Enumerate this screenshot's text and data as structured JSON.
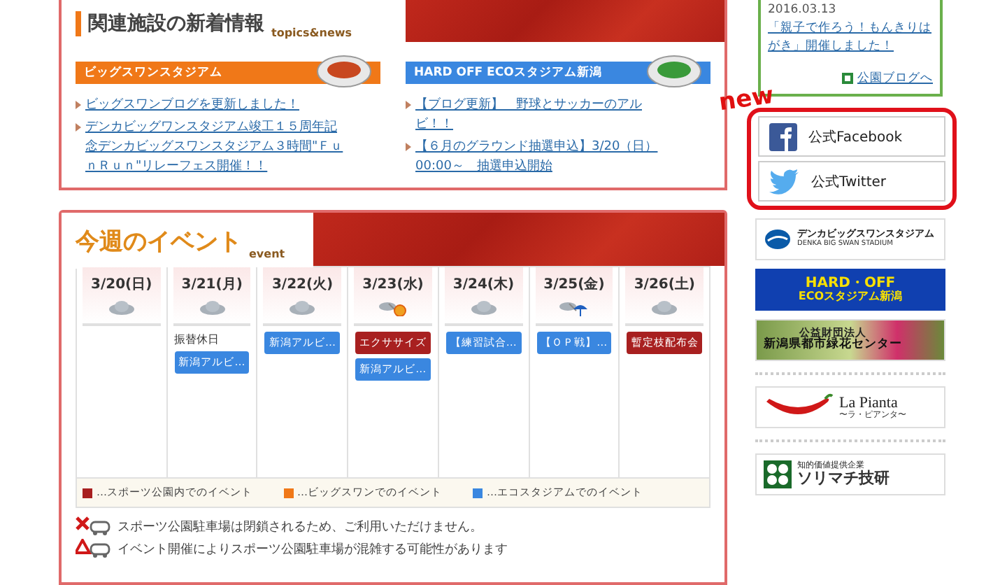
{
  "topics": {
    "title": "関連施設の新着情報",
    "subtitle": "topics&news",
    "venues": [
      {
        "name": "ビッグスワンスタジアム",
        "kind": "swan",
        "links": [
          "ビッグスワンブログを更新しました！",
          "デンカビッグワンスタジアム竣工１５周年記念デンカビッグスワンスタジアム３時間\"ＦｕｎＲｕｎ\"リレーフェス開催！！"
        ]
      },
      {
        "name": "HARD OFF ECOスタジアム新潟",
        "kind": "eco",
        "links": [
          "【ブログ更新】　野球とサッカーのアルビ！！",
          "【６月のグラウンド抽選申込】3/20（日）00:00～　抽選申込開始"
        ]
      }
    ]
  },
  "events": {
    "title": "今週のイベント",
    "subtitle": "event",
    "days": [
      {
        "date": "3/20(日)",
        "kind": "cloudy"
      },
      {
        "date": "3/21(月)",
        "kind": "cloudy",
        "note": "振替休日",
        "items": [
          {
            "label": "新潟アルビ…",
            "color": "#3a87e0"
          }
        ]
      },
      {
        "date": "3/22(火)",
        "kind": "cloudy",
        "items": [
          {
            "label": "新潟アルビ…",
            "color": "#3a87e0"
          }
        ]
      },
      {
        "date": "3/23(水)",
        "kind": "cloudy-sun",
        "items": [
          {
            "label": "エクササイズ",
            "color": "#a82020"
          },
          {
            "label": "新潟アルビ…",
            "color": "#3a87e0"
          }
        ]
      },
      {
        "date": "3/24(木)",
        "kind": "cloudy",
        "items": [
          {
            "label": "【練習試合…",
            "color": "#3a87e0"
          }
        ]
      },
      {
        "date": "3/25(金)",
        "kind": "cloudy-rain",
        "items": [
          {
            "label": "【ＯＰ戦】…",
            "color": "#3a87e0"
          }
        ]
      },
      {
        "date": "3/26(土)",
        "kind": "cloudy",
        "items": [
          {
            "label": "暫定枝配布会",
            "color": "#a82020"
          }
        ]
      }
    ],
    "legend": [
      {
        "label": "…スポーツ公園内でのイベント",
        "color": "#a82020"
      },
      {
        "label": "…ビッグスワンでのイベント",
        "color": "#f07818"
      },
      {
        "label": "…エコスタジアムでのイベント",
        "color": "#3a87e0"
      }
    ],
    "notices": [
      {
        "kind": "closed",
        "text": "スポーツ公園駐車場は閉鎖されるため、ご利用いただけません。"
      },
      {
        "kind": "warning",
        "text": "イベント開催によりスポーツ公園駐車場が混雑する可能性があります"
      }
    ]
  },
  "blog": {
    "date": "2016.03.13",
    "link": "「親子で作ろう！もんきりはがき」開催しました！",
    "more": "公園ブログへ"
  },
  "social": {
    "badge": "new",
    "buttons": [
      {
        "kind": "facebook",
        "label": "公式Facebook"
      },
      {
        "kind": "twitter",
        "label": "公式Twitter"
      }
    ]
  },
  "banners": [
    {
      "kind": "swan",
      "title": "デンカビッグスワンスタジアム",
      "sub": "DENKA BIG SWAN STADIUM"
    },
    {
      "kind": "hardoff",
      "title": "HARD・OFF",
      "sub": "ECOスタジアム新潟"
    },
    {
      "kind": "green",
      "title": "公益財団法人",
      "sub": "新潟県都市緑花センター"
    },
    {
      "kind": "pianta",
      "title": "La Pianta",
      "sub": "〜ラ・ピアンタ〜"
    },
    {
      "kind": "solimachi",
      "title": "知的価値提供企業",
      "sub": "ソリマチ技研"
    }
  ]
}
